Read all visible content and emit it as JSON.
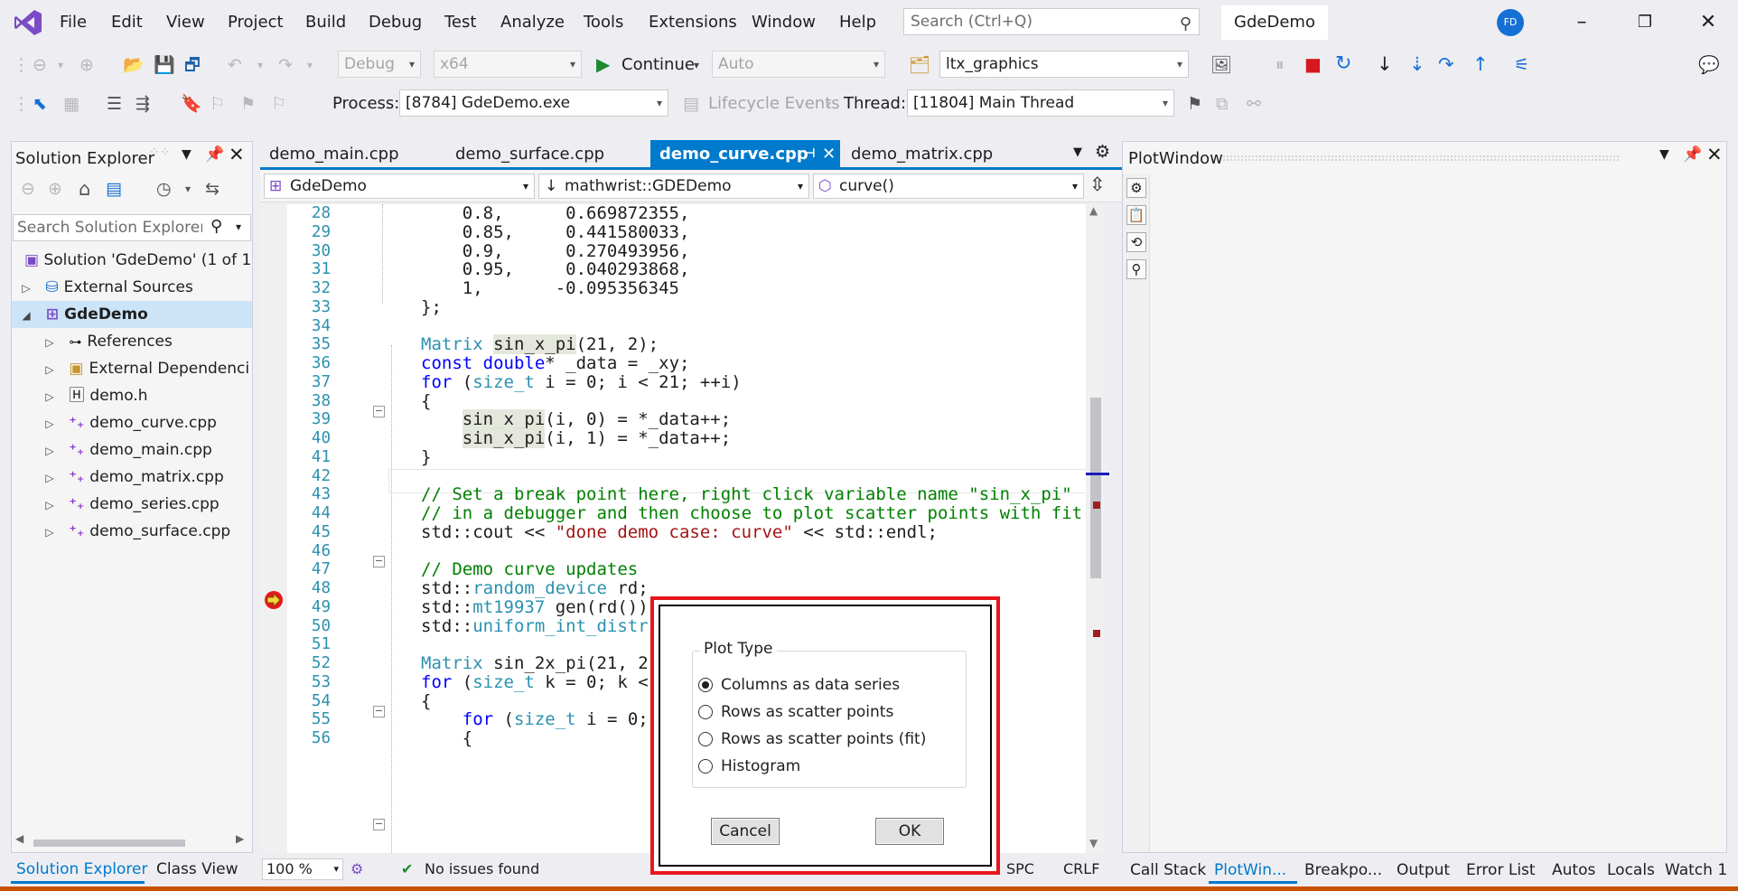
{
  "menu": [
    "File",
    "Edit",
    "View",
    "Project",
    "Build",
    "Debug",
    "Test",
    "Analyze",
    "Tools",
    "Extensions",
    "Window",
    "Help"
  ],
  "search": {
    "placeholder": "Search (Ctrl+Q)"
  },
  "app_title": "GdeDemo",
  "user_initials": "FD",
  "toolbar1": {
    "config": "Debug",
    "platform": "x64",
    "continue_label": "Continue",
    "auto": "Auto",
    "graphics_lib": "ltx_graphics"
  },
  "toolbar2": {
    "process_label": "Process:",
    "process": "[8784] GdeDemo.exe",
    "lifecycle_label": "Lifecycle Events",
    "thread_label": "Thread:",
    "thread": "[11804] Main Thread"
  },
  "solution_explorer": {
    "title": "Solution Explorer",
    "search_placeholder": "Search Solution Explorer (",
    "solution": "Solution 'GdeDemo' (1 of 1",
    "items": [
      {
        "label": "External Sources",
        "depth": 1,
        "bold": false
      },
      {
        "label": "GdeDemo",
        "depth": 1,
        "bold": true
      },
      {
        "label": "References",
        "depth": 2,
        "bold": false
      },
      {
        "label": "External Dependenci",
        "depth": 2,
        "bold": false
      },
      {
        "label": "demo.h",
        "depth": 2,
        "bold": false
      },
      {
        "label": "demo_curve.cpp",
        "depth": 2,
        "bold": false
      },
      {
        "label": "demo_main.cpp",
        "depth": 2,
        "bold": false
      },
      {
        "label": "demo_matrix.cpp",
        "depth": 2,
        "bold": false
      },
      {
        "label": "demo_series.cpp",
        "depth": 2,
        "bold": false
      },
      {
        "label": "demo_surface.cpp",
        "depth": 2,
        "bold": false
      }
    ],
    "tab_solution": "Solution Explorer",
    "tab_class": "Class View"
  },
  "editor": {
    "tabs": [
      "demo_main.cpp",
      "demo_surface.cpp",
      "demo_curve.cpp",
      "demo_matrix.cpp"
    ],
    "active_tab": "demo_curve.cpp",
    "nav_project": "GdeDemo",
    "nav_scope": "mathwrist::GDEDemo",
    "nav_member": "curve()",
    "zoom": "100 %",
    "issues": "No issues found",
    "spc": "SPC",
    "crlf": "CRLF"
  },
  "code_lines": [
    {
      "n": "28",
      "t": "    0.8,      0.669872355,"
    },
    {
      "n": "29",
      "t": "    0.85,     0.441580033,"
    },
    {
      "n": "30",
      "t": "    0.9,      0.270493956,"
    },
    {
      "n": "31",
      "t": "    0.95,     0.040293868,"
    },
    {
      "n": "32",
      "t": "    1,       -0.095356345"
    },
    {
      "n": "33",
      "t": "};"
    },
    {
      "n": "34",
      "t": ""
    },
    {
      "n": "35",
      "t": "Matrix sin_x_pi(21, 2);"
    },
    {
      "n": "36",
      "t": "const double* _data = _xy;"
    },
    {
      "n": "37",
      "t": "for (size_t i = 0; i < 21; ++i)"
    },
    {
      "n": "38",
      "t": "{"
    },
    {
      "n": "39",
      "t": "    sin_x_pi(i, 0) = *_data++;"
    },
    {
      "n": "40",
      "t": "    sin_x_pi(i, 1) = *_data++;"
    },
    {
      "n": "41",
      "t": "}"
    },
    {
      "n": "42",
      "t": ""
    },
    {
      "n": "43",
      "t": "// Set a break point here, right click variable name \"sin_x_pi\""
    },
    {
      "n": "44",
      "t": "// in a debugger and then choose to plot scatter points with fit"
    },
    {
      "n": "45",
      "t": "std::cout << \"done demo case: curve\" << std::endl;"
    },
    {
      "n": "46",
      "t": ""
    },
    {
      "n": "47",
      "t": "// Demo curve updates"
    },
    {
      "n": "48",
      "t": "std::random_device rd;"
    },
    {
      "n": "49",
      "t": "std::mt19937 gen(rd());"
    },
    {
      "n": "50",
      "t": "std::uniform_int_distr"
    },
    {
      "n": "51",
      "t": ""
    },
    {
      "n": "52",
      "t": "Matrix sin_2x_pi(21, 2"
    },
    {
      "n": "53",
      "t": "for (size_t k = 0; k <"
    },
    {
      "n": "54",
      "t": "{"
    },
    {
      "n": "55",
      "t": "    for (size_t i = 0; "
    },
    {
      "n": "56",
      "t": "    {"
    }
  ],
  "plot_window": {
    "title": "PlotWindow"
  },
  "dialog": {
    "group_label": "Plot Type",
    "options": [
      "Columns as data series",
      "Rows as scatter points",
      "Rows as scatter points (fit)",
      "Histogram"
    ],
    "selected": 0,
    "cancel": "Cancel",
    "ok": "OK"
  },
  "bottom_tabs": [
    "Call Stack",
    "PlotWin...",
    "Breakpo...",
    "Output",
    "Error List",
    "Autos",
    "Locals",
    "Watch 1"
  ],
  "colors": {
    "accent": "#007acc",
    "breakpoint": "#e8161c",
    "status": "#ca5100"
  }
}
